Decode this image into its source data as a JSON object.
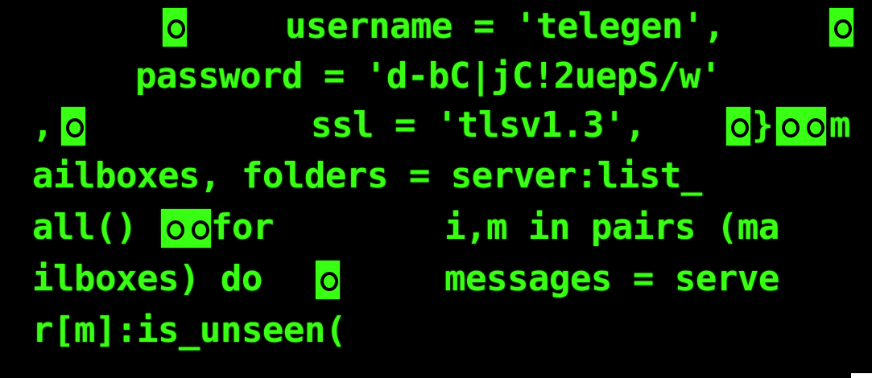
{
  "terminal": {
    "colors": {
      "background": "#000000",
      "foreground": "#39ff14"
    },
    "lines": [
      {
        "segments": [
          {
            "text": "username = 'telegen',"
          }
        ],
        "control_chars": 2
      },
      {
        "segments": [
          {
            "text": "password = 'd-bC|jC!2uepS/w'"
          }
        ],
        "control_chars": 0
      },
      {
        "segments": [
          {
            "text": ","
          },
          {
            "text": "ssl = 'tlsv1.3',"
          },
          {
            "text": "}"
          },
          {
            "text": "m"
          }
        ],
        "control_chars": 4
      },
      {
        "segments": [
          {
            "text": "ailboxes, folders = server:list_"
          }
        ],
        "control_chars": 0
      },
      {
        "segments": [
          {
            "text": "all()"
          },
          {
            "text": "for"
          },
          {
            "text": "i,m in pairs (ma"
          }
        ],
        "control_chars": 2
      },
      {
        "segments": [
          {
            "text": "ilboxes) do"
          },
          {
            "text": "messages = serve"
          }
        ],
        "control_chars": 1
      },
      {
        "segments": [
          {
            "text": "r[m]:is_unseen("
          }
        ],
        "control_chars": 0
      }
    ]
  }
}
